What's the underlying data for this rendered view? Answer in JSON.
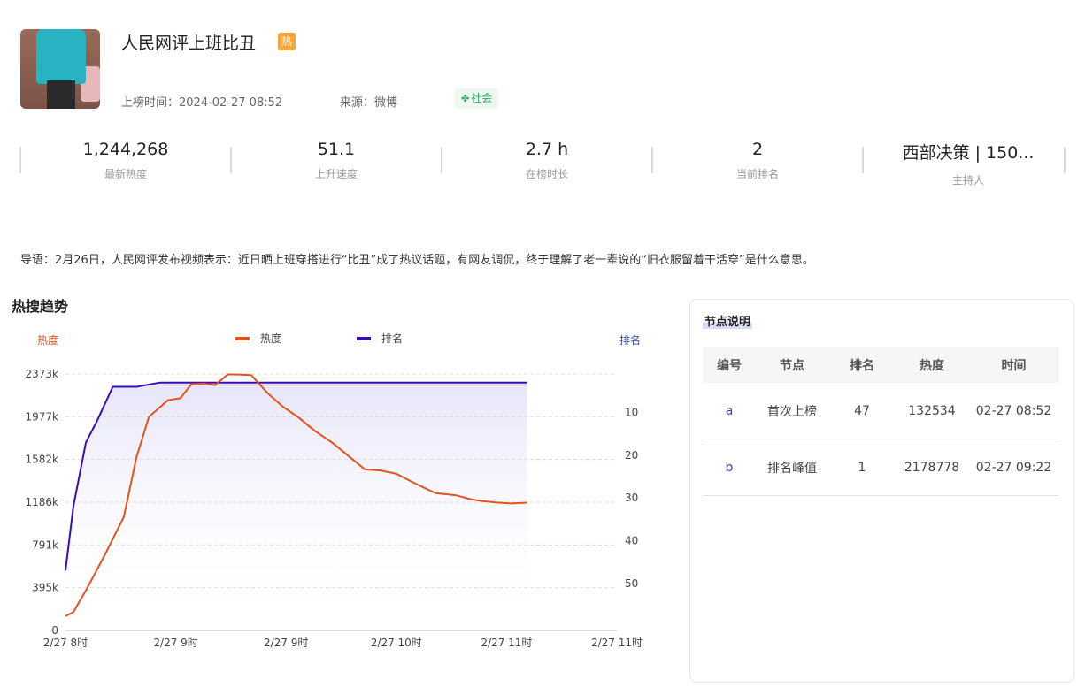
{
  "header": {
    "title": "人民网评上班比丑",
    "hot_badge": "热",
    "listed_time": "上榜时间：2024-02-27 08:52",
    "source": "来源：微博",
    "category_tag": "社会"
  },
  "stats": [
    {
      "value": "1,244,268",
      "label": "最新热度"
    },
    {
      "value": "51.1",
      "label": "上升速度"
    },
    {
      "value": "2.7 h",
      "label": "在榜时长"
    },
    {
      "value": "2",
      "label": "当前排名"
    },
    {
      "value": "西部决策 | 150...",
      "label": "主持人"
    }
  ],
  "intro": "导语：2月26日，人民网评发布视频表示：近日晒上班穿搭进行“比丑”成了热议话题，有网友调侃，终于理解了老一辈说的“旧衣服留着干活穿”是什么意思。",
  "trend": {
    "section_title": "热搜趋势"
  },
  "chart_data": {
    "type": "line",
    "y_left_label": "热度",
    "y_right_label": "排名",
    "legend": [
      "热度",
      "排名"
    ],
    "x_ticks": [
      "2/27 8时",
      "2/27 9时",
      "2/27 9时",
      "2/27 10时",
      "2/27 11时",
      "2/27 11时"
    ],
    "y_left_ticks": [
      "0",
      "395k",
      "791k",
      "1186k",
      "1582k",
      "1977k",
      "2373k"
    ],
    "y_right_ticks": [
      "10",
      "20",
      "30",
      "40",
      "50"
    ],
    "y_left_range": [
      0,
      2373
    ],
    "y_right_range": [
      1,
      61
    ],
    "x_range_hours": [
      8.0,
      11.5
    ],
    "series": [
      {
        "name": "热度",
        "color": "#e0541c",
        "unit": "k",
        "x_hours": [
          8.0,
          8.05,
          8.13,
          8.25,
          8.37,
          8.45,
          8.53,
          8.65,
          8.73,
          8.8,
          8.88,
          8.95,
          9.03,
          9.1,
          9.18,
          9.28,
          9.38,
          9.48,
          9.58,
          9.7,
          9.8,
          9.9,
          10.0,
          10.1,
          10.2,
          10.27,
          10.35,
          10.48,
          10.57,
          10.63,
          10.73,
          10.83,
          10.93
        ],
        "values": [
          132,
          170,
          370,
          700,
          1050,
          1600,
          1977,
          2130,
          2150,
          2280,
          2285,
          2270,
          2370,
          2368,
          2362,
          2200,
          2070,
          1970,
          1850,
          1730,
          1610,
          1490,
          1480,
          1450,
          1375,
          1325,
          1270,
          1250,
          1215,
          1200,
          1185,
          1175,
          1182
        ]
      },
      {
        "name": "排名",
        "color": "#3a0cb8",
        "x_hours": [
          8.0,
          8.05,
          8.13,
          8.2,
          8.3,
          8.45,
          8.6,
          8.7,
          8.8,
          9.0,
          9.2,
          9.5,
          9.8,
          10.0,
          10.2,
          10.5,
          10.93
        ],
        "values": [
          47,
          32,
          17,
          12,
          4,
          4,
          3,
          3,
          3,
          3,
          3,
          3,
          3,
          3,
          3,
          3,
          3
        ]
      }
    ]
  },
  "nodes_panel": {
    "title": "节点说明",
    "columns": [
      "编号",
      "节点",
      "排名",
      "热度",
      "时间"
    ],
    "rows": [
      {
        "id": "a",
        "node": "首次上榜",
        "rank": "47",
        "heat": "132534",
        "time": "02-27 08:52"
      },
      {
        "id": "b",
        "node": "排名峰值",
        "rank": "1",
        "heat": "2178778",
        "time": "02-27 09:22"
      }
    ]
  },
  "colors": {
    "heat_line": "#e0541c",
    "rank_line": "#3a0cb8",
    "tag_green": "#2fa86a",
    "badge_orange": "#f5a53a"
  }
}
